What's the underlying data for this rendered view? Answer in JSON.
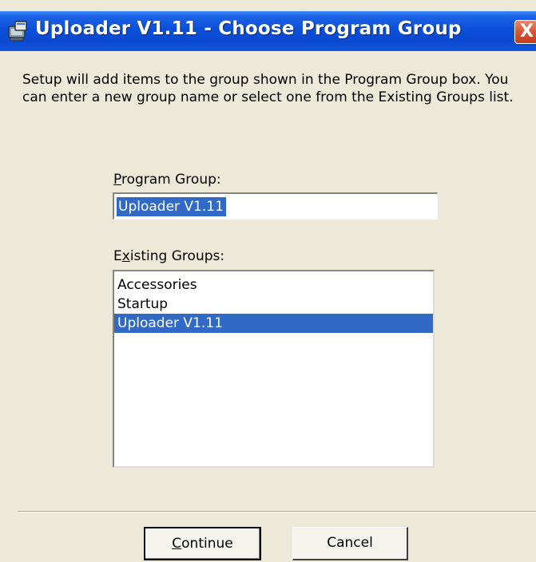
{
  "window": {
    "title": "Uploader V1.11 - Choose Program Group",
    "close_label": "X"
  },
  "description": "Setup will add items to the group shown in the Program Group box. You can enter a new group name or select one from the Existing Groups list.",
  "program_group": {
    "label_mnemonic": "P",
    "label_rest": "rogram Group:",
    "value": "Uploader V1.11"
  },
  "existing_groups": {
    "label_first": "E",
    "label_mnemonic": "x",
    "label_rest": "isting Groups:",
    "items": [
      "Accessories",
      "Startup",
      "Uploader V1.11"
    ],
    "selected": "Uploader V1.11"
  },
  "buttons": {
    "continue_mnemonic": "C",
    "continue_rest": "ontinue",
    "cancel": "Cancel"
  }
}
